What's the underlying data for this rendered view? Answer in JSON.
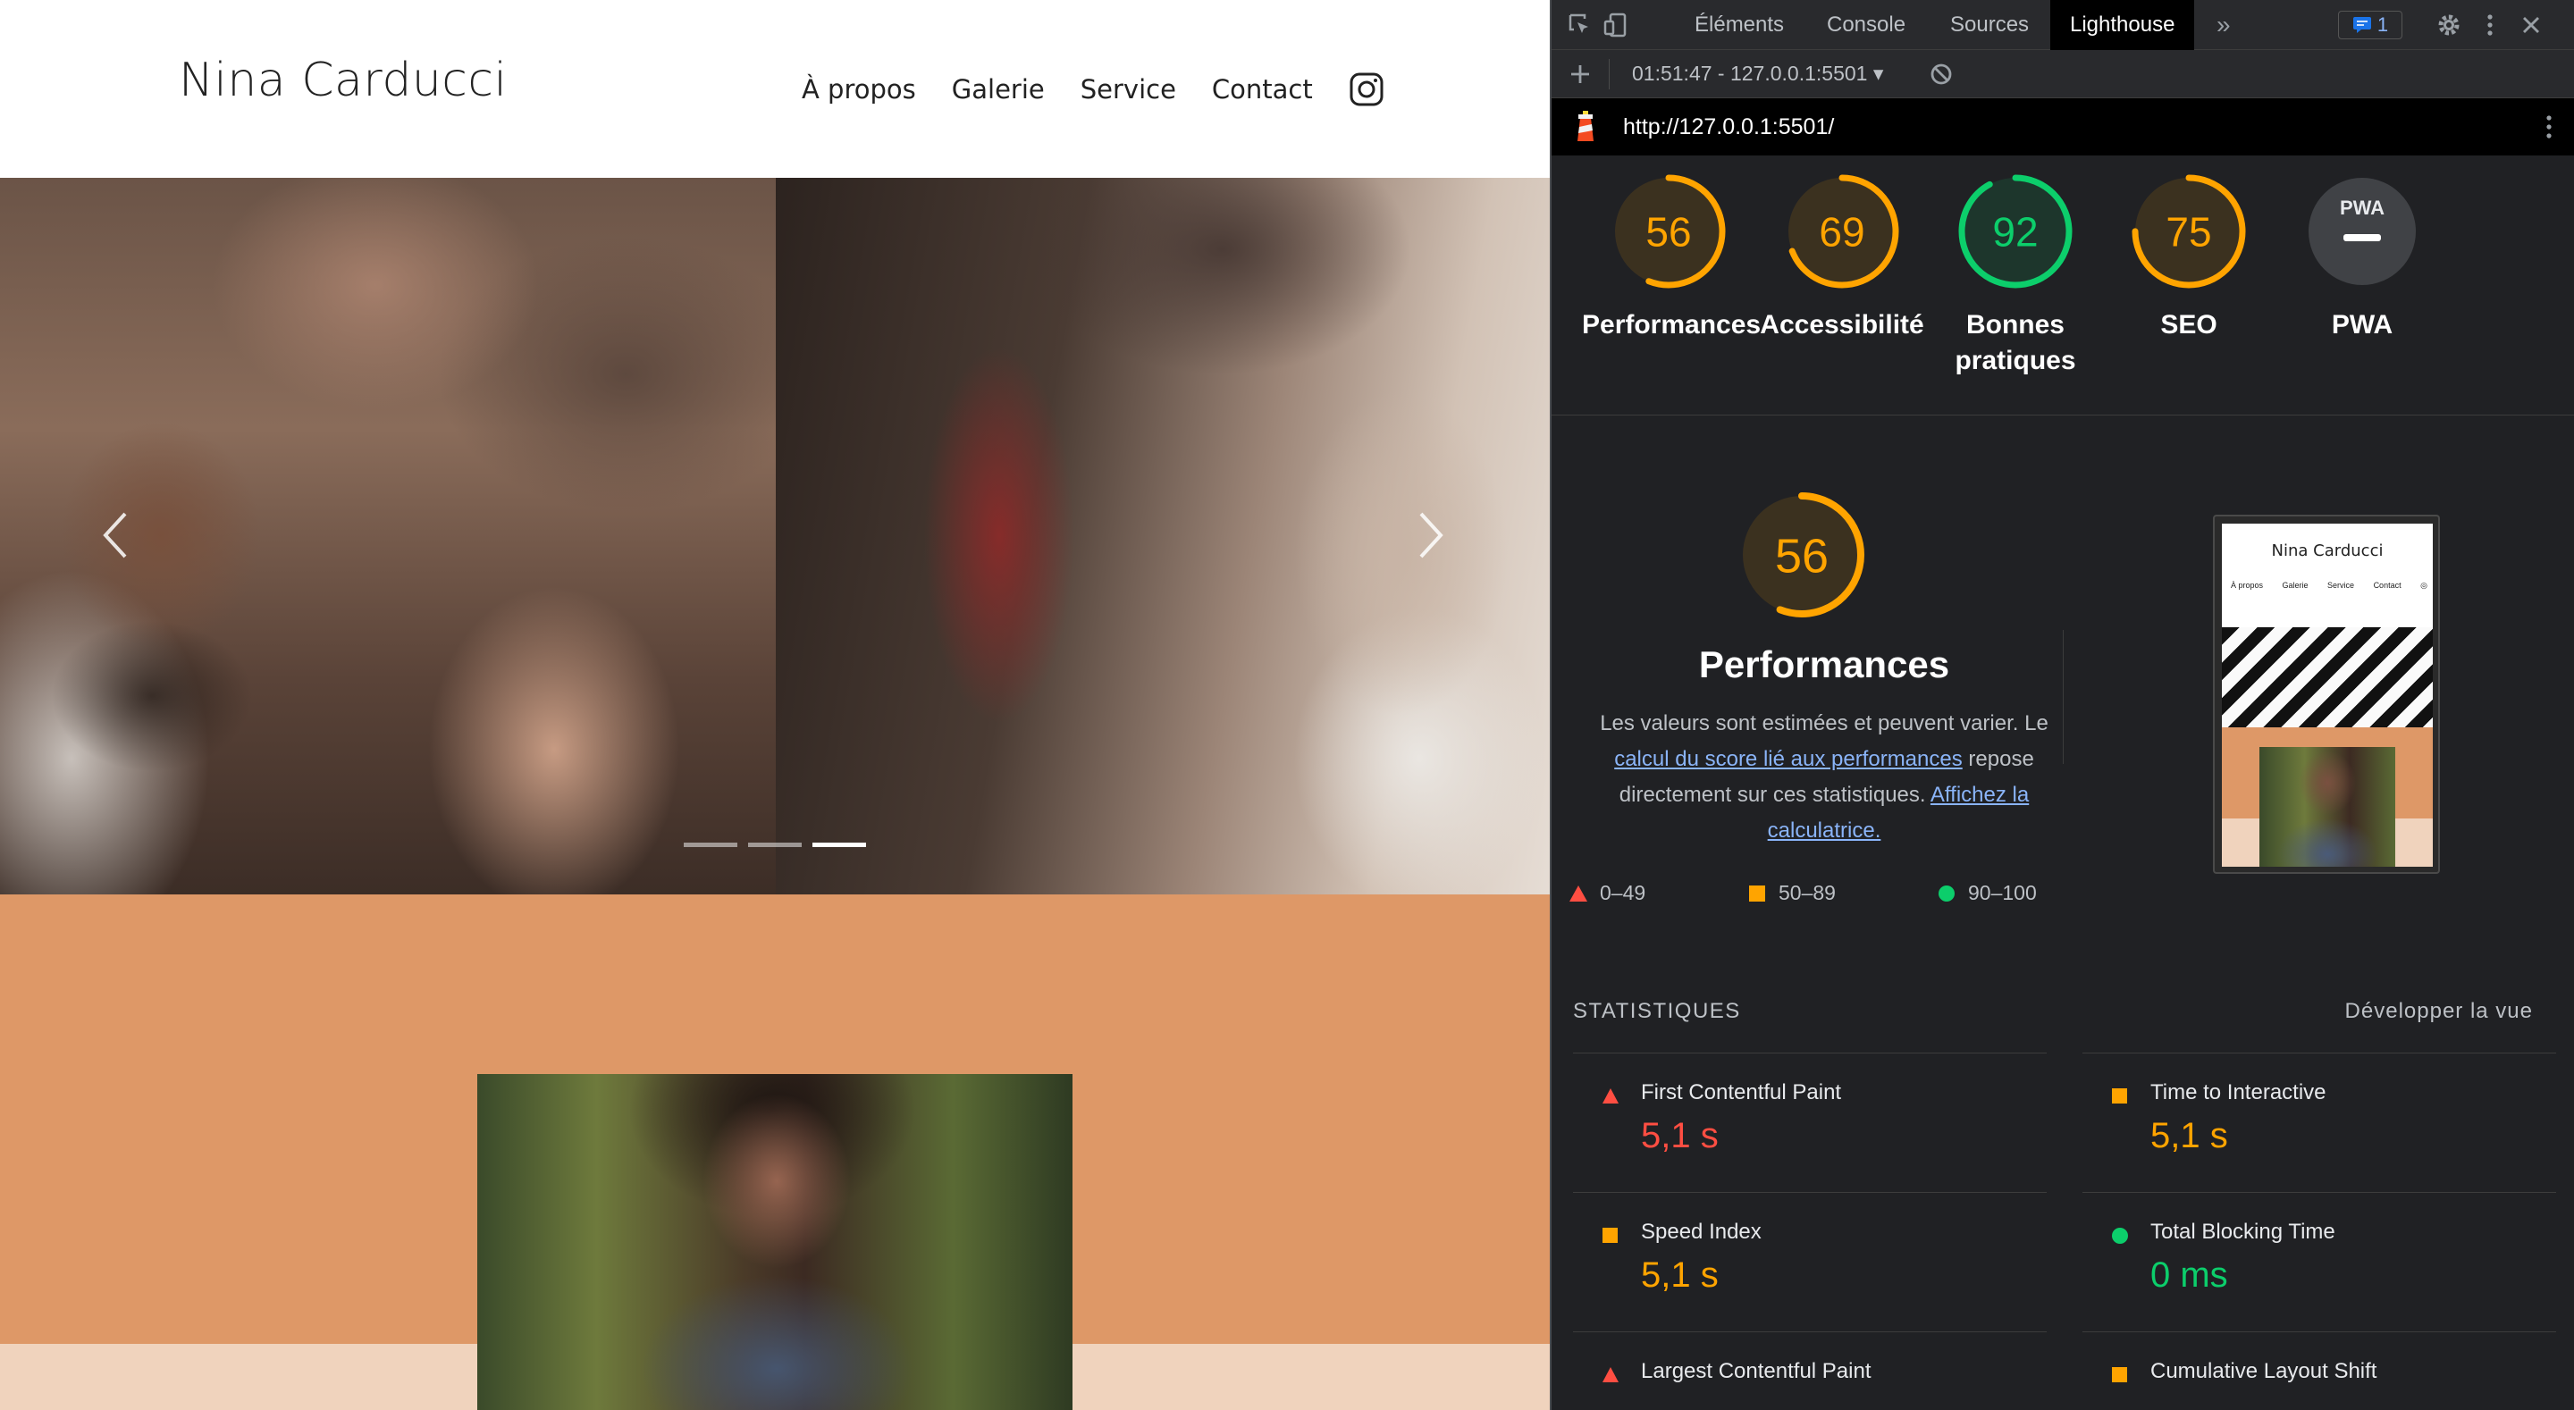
{
  "site": {
    "brand": "Nina Carducci",
    "nav": [
      "À propos",
      "Galerie",
      "Service",
      "Contact"
    ]
  },
  "carousel": {
    "slides": 3,
    "active_slide": 3
  },
  "devtools": {
    "tabs": [
      "Éléments",
      "Console",
      "Sources",
      "Lighthouse"
    ],
    "active_tab": "Lighthouse",
    "more_tabs": "»",
    "issues_count": "1",
    "report_selector": "01:51:47 - 127.0.0.1:5501 ▾",
    "url": "http://127.0.0.1:5501/",
    "gauges": [
      {
        "score": "56",
        "value": 56,
        "label": "Performances",
        "color": "#ffa400"
      },
      {
        "score": "69",
        "value": 69,
        "label": "Accessibilité",
        "color": "#ffa400"
      },
      {
        "score": "92",
        "value": 92,
        "label": "Bonnes pratiques",
        "color": "#0cce6b"
      },
      {
        "score": "75",
        "value": 75,
        "label": "SEO",
        "color": "#ffa400"
      },
      {
        "score": "",
        "value": 0,
        "label": "PWA",
        "color": "#9aa0a6"
      }
    ],
    "pwa_badge": "PWA",
    "performance": {
      "score": "56",
      "value": 56,
      "title": "Performances",
      "desc_1": "Les valeurs sont estimées et peuvent varier. Le",
      "desc_link_1": "calcul du score lié aux performances",
      "desc_2": "repose directement sur ces statistiques.",
      "desc_link_2": "Affichez la calculatrice."
    },
    "legend": [
      {
        "range": "0–49",
        "shape": "triangle",
        "color": "#ff4e42"
      },
      {
        "range": "50–89",
        "shape": "square",
        "color": "#ffa400"
      },
      {
        "range": "90–100",
        "shape": "circle",
        "color": "#0cce6b"
      }
    ],
    "thumbnail": {
      "title": "Nina Carducci",
      "nav": [
        "À propos",
        "Galerie",
        "Service",
        "Contact"
      ]
    },
    "stats": {
      "heading": "STATISTIQUES",
      "expand": "Développer la vue",
      "items": [
        {
          "name": "First Contentful Paint",
          "value": "5,1 s",
          "status": "fail",
          "color": "#ff4e42"
        },
        {
          "name": "Time to Interactive",
          "value": "5,1 s",
          "status": "average",
          "color": "#ffa400"
        },
        {
          "name": "Speed Index",
          "value": "5,1 s",
          "status": "average",
          "color": "#ffa400"
        },
        {
          "name": "Total Blocking Time",
          "value": "0 ms",
          "status": "pass",
          "color": "#0cce6b"
        },
        {
          "name": "Largest Contentful Paint",
          "value": "",
          "status": "fail",
          "color": "#ff4e42"
        },
        {
          "name": "Cumulative Layout Shift",
          "value": "",
          "status": "average",
          "color": "#ffa400"
        }
      ]
    }
  }
}
